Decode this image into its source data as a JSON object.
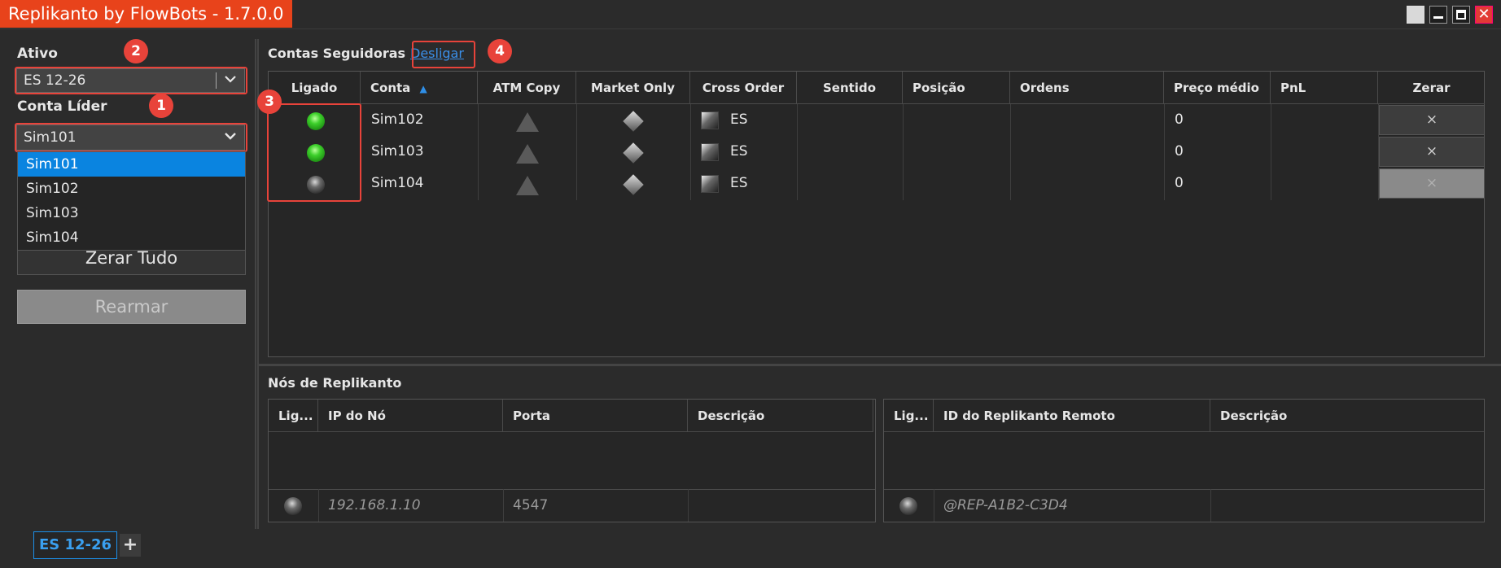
{
  "window": {
    "title": "Replikanto by FlowBots - 1.7.0.0",
    "close_glyph": "✕"
  },
  "left": {
    "ativo_label": "Ativo",
    "ativo_value": "ES 12-26",
    "conta_lider_label": "Conta Líder",
    "conta_lider_value": "Sim101",
    "dropdown_options": [
      "Sim101",
      "Sim102",
      "Sim103",
      "Sim104"
    ],
    "selected_option": "Sim101",
    "zerar_tudo_label": "Zerar Tudo",
    "rearmar_label": "Rearmar"
  },
  "annotations": [
    "1",
    "2",
    "3",
    "4"
  ],
  "followers": {
    "section_title": "Contas Seguidoras",
    "desligar_link": "Desligar",
    "columns": [
      "Ligado",
      "Conta",
      "ATM Copy",
      "Market Only",
      "Cross Order",
      "Sentido",
      "Posição",
      "Ordens",
      "Preço médio",
      "PnL",
      "Zerar"
    ],
    "sort_indicator": "▲",
    "rows": [
      {
        "ligado": "on",
        "conta": "Sim102",
        "cross": "ES",
        "preco": "0",
        "zerar": "×",
        "zerar_enabled": true
      },
      {
        "ligado": "on",
        "conta": "Sim103",
        "cross": "ES",
        "preco": "0",
        "zerar": "×",
        "zerar_enabled": true
      },
      {
        "ligado": "off",
        "conta": "Sim104",
        "cross": "ES",
        "preco": "0",
        "zerar": "×",
        "zerar_enabled": false
      }
    ]
  },
  "nodes": {
    "section_title": "Nós de Replikanto",
    "left_columns": [
      "Lig...",
      "IP do Nó",
      "Porta",
      "Descrição"
    ],
    "left_row": {
      "ip": "192.168.1.10",
      "porta": "4547"
    },
    "right_columns": [
      "Lig...",
      "ID do Replikanto Remoto",
      "Descrição"
    ],
    "right_row": {
      "id": "@REP-A1B2-C3D4"
    }
  },
  "tabs": {
    "active": "ES 12-26",
    "add": "+"
  },
  "colors": {
    "accent_red": "#e8431b",
    "selection_blue": "#0a84e0",
    "annotation_red": "#e8433a"
  }
}
